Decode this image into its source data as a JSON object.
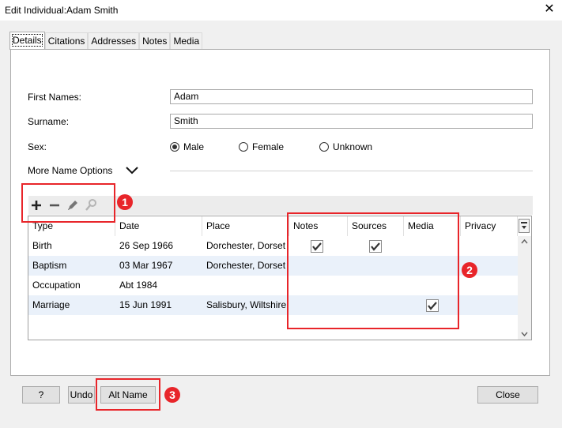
{
  "window": {
    "title": "Edit Individual:Adam Smith",
    "close_symbol": "✕"
  },
  "tabs": [
    {
      "label": "Details",
      "active": true
    },
    {
      "label": "Citations"
    },
    {
      "label": "Addresses"
    },
    {
      "label": "Notes"
    },
    {
      "label": "Media"
    }
  ],
  "form": {
    "first_names_label": "First Names:",
    "first_names_value": "Adam",
    "surname_label": "Surname:",
    "surname_value": "Smith",
    "sex_label": "Sex:",
    "sex_options": [
      "Male",
      "Female",
      "Unknown"
    ],
    "sex_selected": "Male",
    "more_options_label": "More Name Options"
  },
  "toolbar": {
    "icons": [
      "add-icon",
      "remove-icon",
      "edit-icon",
      "share-icon"
    ]
  },
  "grid": {
    "columns": [
      "Type",
      "Date",
      "Place",
      "Notes",
      "Sources",
      "Media",
      "Privacy"
    ],
    "rows": [
      {
        "type": "Birth",
        "date": "26 Sep 1966",
        "place": "Dorchester, Dorset",
        "notes": true,
        "sources": true,
        "media": false
      },
      {
        "type": "Baptism",
        "date": "03 Mar 1967",
        "place": "Dorchester, Dorset",
        "notes": false,
        "sources": false,
        "media": false
      },
      {
        "type": "Occupation",
        "date": "Abt 1984",
        "place": "",
        "notes": false,
        "sources": false,
        "media": false
      },
      {
        "type": "Marriage",
        "date": "15 Jun 1991",
        "place": "Salisbury, Wiltshire",
        "notes": false,
        "sources": false,
        "media": true
      }
    ]
  },
  "annotations": {
    "badge1": "1",
    "badge2": "2",
    "badge3": "3",
    "color": "#e8252a"
  },
  "buttons": {
    "help": "?",
    "undo": "Undo",
    "alt_name": "Alt Name",
    "close": "Close"
  }
}
